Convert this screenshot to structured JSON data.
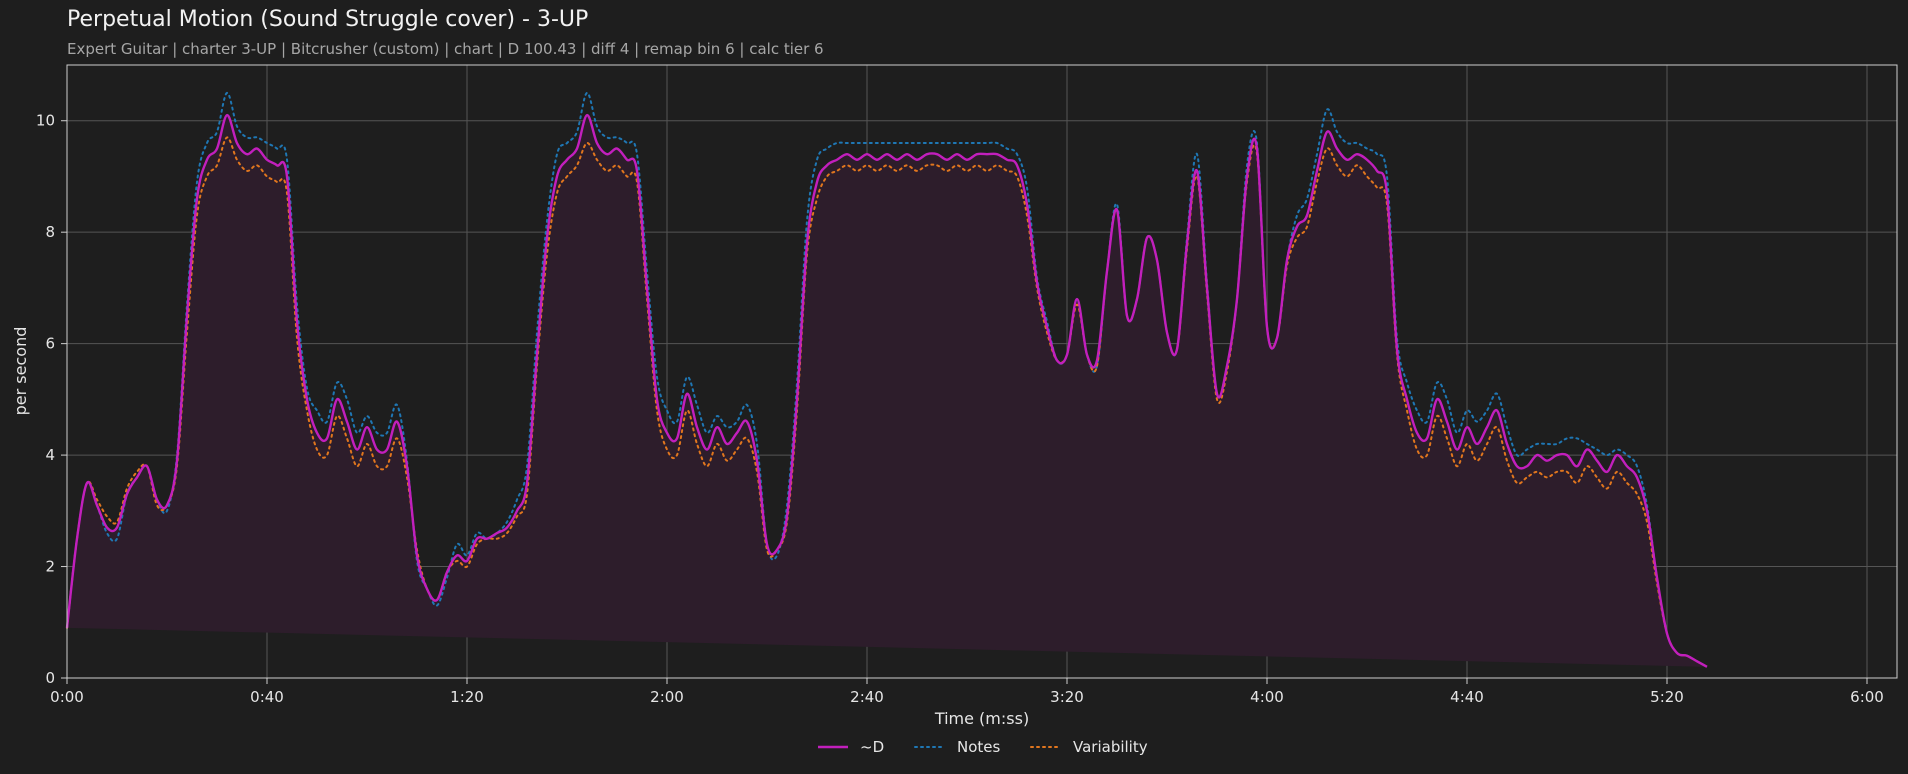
{
  "chart_data": {
    "type": "line",
    "title": "Perpetual Motion (Sound Struggle cover) - 3-UP",
    "subtitle": "Expert Guitar  |  charter 3-UP  |  Bitcrusher (custom)  |  chart  |  D 100.43  |  diff 4  |  remap bin 6  |  calc tier 6",
    "xlabel": "Time (m:ss)",
    "ylabel": "per second",
    "xlim": [
      0,
      366
    ],
    "ylim": [
      0,
      11
    ],
    "x_ticks": [
      0,
      40,
      80,
      120,
      160,
      200,
      240,
      280,
      320,
      360
    ],
    "x_tick_labels": [
      "0:00",
      "0:40",
      "1:20",
      "2:00",
      "2:40",
      "3:20",
      "4:00",
      "4:40",
      "5:20",
      "6:00"
    ],
    "y_ticks": [
      0,
      2,
      4,
      6,
      8,
      10
    ],
    "y_tick_labels": [
      "0",
      "2",
      "4",
      "6",
      "8",
      "10"
    ],
    "grid": true,
    "legend_position": "bottom-center",
    "background": "#1e1e1e",
    "fill_color": "#2d1d2b",
    "x": [
      0,
      2,
      4,
      6,
      8,
      10,
      12,
      14,
      16,
      18,
      20,
      22,
      24,
      26,
      28,
      30,
      32,
      34,
      36,
      38,
      40,
      42,
      44,
      46,
      48,
      50,
      52,
      54,
      56,
      58,
      60,
      62,
      64,
      66,
      68,
      70,
      72,
      74,
      76,
      78,
      80,
      82,
      84,
      86,
      88,
      90,
      92,
      94,
      96,
      98,
      100,
      102,
      104,
      106,
      108,
      110,
      112,
      114,
      116,
      118,
      120,
      122,
      124,
      126,
      128,
      130,
      132,
      134,
      136,
      138,
      140,
      142,
      144,
      146,
      148,
      150,
      152,
      154,
      156,
      158,
      160,
      162,
      164,
      166,
      168,
      170,
      172,
      174,
      176,
      178,
      180,
      182,
      184,
      186,
      188,
      190,
      192,
      194,
      196,
      198,
      200,
      202,
      204,
      206,
      208,
      210,
      212,
      214,
      216,
      218,
      220,
      222,
      224,
      226,
      228,
      230,
      232,
      234,
      236,
      238,
      240,
      242,
      244,
      246,
      248,
      250,
      252,
      254,
      256,
      258,
      260,
      262,
      264,
      266,
      268,
      270,
      272,
      274,
      276,
      278,
      280,
      282,
      284,
      286,
      288,
      290,
      292,
      294,
      296,
      298,
      300,
      302,
      304,
      306,
      308,
      310,
      312,
      314,
      316,
      318,
      320,
      322,
      324,
      326,
      328,
      330,
      332,
      334,
      336,
      338,
      340,
      342,
      344,
      346,
      348,
      350,
      352,
      354,
      356,
      358,
      360,
      362,
      364,
      366
    ],
    "series": [
      {
        "name": "~D",
        "color": "#c21fbd",
        "style": "solid",
        "values": [
          0.9,
          2.5,
          3.5,
          3.1,
          2.7,
          2.7,
          3.3,
          3.6,
          3.8,
          3.2,
          3.1,
          3.9,
          6.5,
          8.6,
          9.3,
          9.5,
          10.1,
          9.6,
          9.4,
          9.5,
          9.3,
          9.2,
          9.0,
          6.4,
          5.0,
          4.4,
          4.3,
          5.0,
          4.6,
          4.1,
          4.5,
          4.1,
          4.1,
          4.6,
          3.8,
          2.2,
          1.6,
          1.4,
          1.9,
          2.2,
          2.1,
          2.5,
          2.5,
          2.6,
          2.7,
          3.0,
          3.5,
          5.8,
          7.9,
          9.0,
          9.3,
          9.5,
          10.1,
          9.6,
          9.4,
          9.5,
          9.3,
          9.1,
          7.0,
          5.0,
          4.4,
          4.3,
          5.1,
          4.5,
          4.1,
          4.5,
          4.2,
          4.4,
          4.6,
          3.9,
          2.4,
          2.3,
          2.9,
          5.0,
          7.8,
          8.9,
          9.2,
          9.3,
          9.4,
          9.3,
          9.4,
          9.3,
          9.4,
          9.3,
          9.4,
          9.3,
          9.4,
          9.4,
          9.3,
          9.4,
          9.3,
          9.4,
          9.4,
          9.4,
          9.3,
          9.2,
          8.5,
          7.1,
          6.3,
          5.7,
          5.8,
          6.8,
          5.8,
          5.7,
          7.3,
          8.4,
          6.5,
          6.8,
          7.9,
          7.5,
          6.2,
          5.9,
          7.8,
          9.1,
          7.0,
          5.1,
          5.6,
          6.8,
          9.0,
          9.5,
          6.3,
          6.1,
          7.5,
          8.1,
          8.3,
          9.1,
          9.8,
          9.5,
          9.3,
          9.4,
          9.3,
          9.1,
          8.7,
          5.9,
          5.0,
          4.4,
          4.3,
          5.0,
          4.6,
          4.1,
          4.5,
          4.2,
          4.5,
          4.8,
          4.2,
          3.8,
          3.8,
          4.0,
          3.9,
          4.0,
          4.0,
          3.8,
          4.1,
          3.9,
          3.7,
          4.0,
          3.8,
          3.6,
          3.0,
          1.8,
          0.8,
          0.45,
          0.4,
          0.3,
          0.2,
          0.1
        ]
      },
      {
        "name": "Notes",
        "color": "#1f77b4",
        "style": "dotted",
        "values": [
          0.9,
          2.5,
          3.5,
          3.1,
          2.6,
          2.5,
          3.3,
          3.6,
          3.8,
          3.2,
          3.0,
          4.0,
          6.7,
          8.9,
          9.6,
          9.8,
          10.5,
          9.9,
          9.7,
          9.7,
          9.6,
          9.5,
          9.3,
          6.7,
          5.2,
          4.8,
          4.6,
          5.3,
          5.0,
          4.4,
          4.7,
          4.4,
          4.4,
          4.9,
          3.9,
          2.1,
          1.6,
          1.3,
          1.8,
          2.4,
          2.2,
          2.6,
          2.5,
          2.6,
          2.8,
          3.2,
          3.8,
          6.2,
          8.2,
          9.4,
          9.6,
          9.8,
          10.5,
          9.9,
          9.7,
          9.7,
          9.6,
          9.4,
          7.3,
          5.4,
          4.8,
          4.6,
          5.4,
          4.9,
          4.4,
          4.7,
          4.5,
          4.6,
          4.9,
          4.2,
          2.4,
          2.2,
          3.1,
          5.3,
          8.2,
          9.3,
          9.5,
          9.6,
          9.6,
          9.6,
          9.6,
          9.6,
          9.6,
          9.6,
          9.6,
          9.6,
          9.6,
          9.6,
          9.6,
          9.6,
          9.6,
          9.6,
          9.6,
          9.6,
          9.5,
          9.4,
          8.8,
          7.2,
          6.4,
          5.7,
          5.8,
          6.8,
          5.8,
          5.6,
          7.3,
          8.5,
          6.5,
          6.8,
          7.9,
          7.5,
          6.2,
          5.9,
          7.9,
          9.4,
          7.1,
          5.1,
          5.6,
          6.8,
          9.2,
          9.6,
          6.3,
          6.1,
          7.5,
          8.3,
          8.6,
          9.4,
          10.2,
          9.8,
          9.6,
          9.6,
          9.5,
          9.4,
          9.0,
          6.1,
          5.3,
          4.8,
          4.6,
          5.3,
          5.0,
          4.4,
          4.8,
          4.6,
          4.8,
          5.1,
          4.5,
          4.0,
          4.1,
          4.2,
          4.2,
          4.2,
          4.3,
          4.3,
          4.2,
          4.1,
          4.0,
          4.1,
          4.0,
          3.8,
          3.1,
          1.8,
          0.8,
          0.45,
          0.4,
          0.3,
          0.2,
          0.1
        ]
      },
      {
        "name": "Variability",
        "color": "#e1761e",
        "style": "dotted",
        "values": [
          0.9,
          2.5,
          3.5,
          3.2,
          2.9,
          2.8,
          3.4,
          3.7,
          3.8,
          3.1,
          3.1,
          3.8,
          6.2,
          8.3,
          9.0,
          9.2,
          9.7,
          9.3,
          9.1,
          9.2,
          9.0,
          8.9,
          8.7,
          6.1,
          4.8,
          4.1,
          4.0,
          4.7,
          4.3,
          3.8,
          4.2,
          3.8,
          3.8,
          4.3,
          3.6,
          2.3,
          1.6,
          1.4,
          1.9,
          2.1,
          2.0,
          2.4,
          2.5,
          2.5,
          2.6,
          2.9,
          3.3,
          5.6,
          7.6,
          8.7,
          9.0,
          9.2,
          9.6,
          9.3,
          9.1,
          9.2,
          9.0,
          8.9,
          6.8,
          4.8,
          4.1,
          4.0,
          4.8,
          4.2,
          3.8,
          4.2,
          3.9,
          4.1,
          4.3,
          3.7,
          2.3,
          2.3,
          2.8,
          4.8,
          7.6,
          8.6,
          9.0,
          9.1,
          9.2,
          9.1,
          9.2,
          9.1,
          9.2,
          9.1,
          9.2,
          9.1,
          9.2,
          9.2,
          9.1,
          9.2,
          9.1,
          9.2,
          9.1,
          9.2,
          9.1,
          9.0,
          8.3,
          7.0,
          6.2,
          5.7,
          5.8,
          6.7,
          5.8,
          5.6,
          7.3,
          8.4,
          6.5,
          6.8,
          7.9,
          7.5,
          6.2,
          5.9,
          7.7,
          9.0,
          6.9,
          5.0,
          5.5,
          6.8,
          8.9,
          9.4,
          6.3,
          6.1,
          7.4,
          7.9,
          8.1,
          8.9,
          9.5,
          9.2,
          9.0,
          9.2,
          9.0,
          8.8,
          8.5,
          5.8,
          4.8,
          4.1,
          4.0,
          4.7,
          4.3,
          3.8,
          4.2,
          3.9,
          4.2,
          4.5,
          3.9,
          3.5,
          3.6,
          3.7,
          3.6,
          3.7,
          3.7,
          3.5,
          3.8,
          3.6,
          3.4,
          3.7,
          3.5,
          3.3,
          2.8,
          1.7,
          0.8,
          0.45,
          0.4,
          0.3,
          0.2,
          0.1
        ]
      }
    ]
  }
}
